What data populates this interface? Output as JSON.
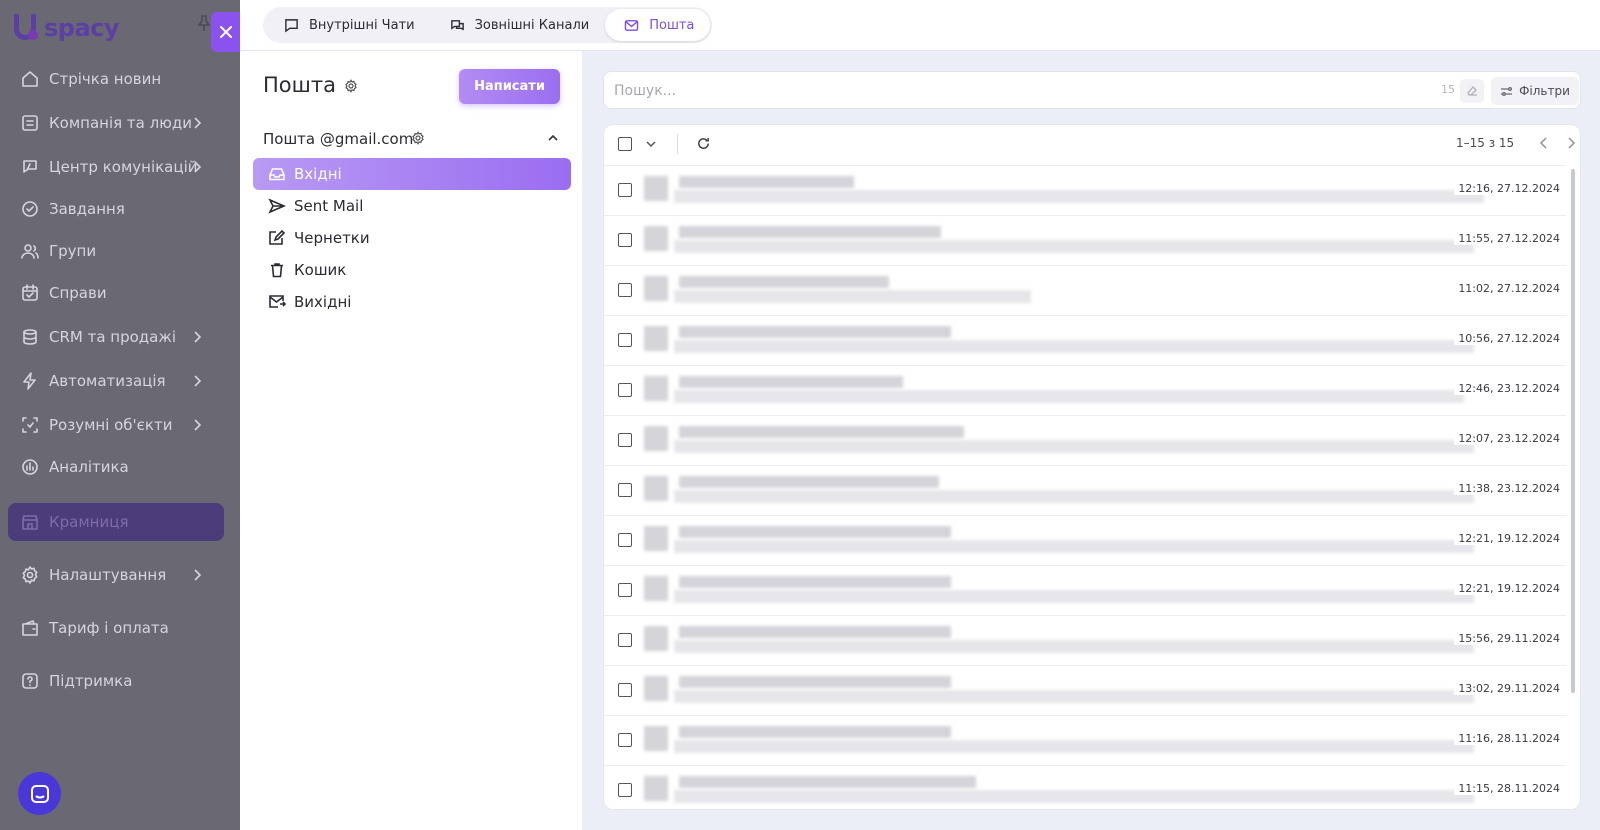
{
  "app": {
    "logo_text": "spacy"
  },
  "sidebar": {
    "items": [
      {
        "label": "Стрічка новин",
        "icon": "home-icon",
        "chevron": false
      },
      {
        "label": "Компанія та люди",
        "icon": "company-icon",
        "chevron": true
      },
      {
        "label": "Центр комунікацій",
        "icon": "communications-icon",
        "chevron": true
      },
      {
        "label": "Завдання",
        "icon": "tasks-icon",
        "chevron": false
      },
      {
        "label": "Групи",
        "icon": "groups-icon",
        "chevron": false
      },
      {
        "label": "Справи",
        "icon": "calendar-icon",
        "chevron": false
      },
      {
        "label": "CRM та продажі",
        "icon": "crm-icon",
        "chevron": true
      },
      {
        "label": "Автоматизація",
        "icon": "lightning-icon",
        "chevron": true
      },
      {
        "label": "Розумні об'єкти",
        "icon": "smart-objects-icon",
        "chevron": true
      },
      {
        "label": "Аналітика",
        "icon": "analytics-icon",
        "chevron": false
      },
      {
        "label": "Крамниця",
        "icon": "store-icon",
        "chevron": false,
        "active": true
      },
      {
        "label": "Налаштування",
        "icon": "gear-icon",
        "chevron": true
      },
      {
        "label": "Тариф і оплата",
        "icon": "wallet-icon",
        "chevron": false
      },
      {
        "label": "Підтримка",
        "icon": "help-icon",
        "chevron": false
      }
    ]
  },
  "tabs": [
    {
      "label": "Внутрішні Чати",
      "icon": "chat-icon",
      "active": false
    },
    {
      "label": "Зовнішні Канали",
      "icon": "channels-icon",
      "active": false
    },
    {
      "label": "Пошта",
      "icon": "mail-icon",
      "active": true
    }
  ],
  "mail": {
    "title": "Пошта",
    "write_button": "Написати",
    "account": "Пошта @gmail.com",
    "folders": [
      {
        "label": "Вхідні",
        "icon": "inbox-icon",
        "active": true
      },
      {
        "label": "Sent Mail",
        "icon": "send-icon",
        "active": false
      },
      {
        "label": "Чернетки",
        "icon": "edit-icon",
        "active": false
      },
      {
        "label": "Кошик",
        "icon": "trash-icon",
        "active": false
      },
      {
        "label": "Вихідні",
        "icon": "outbox-icon",
        "active": false
      }
    ]
  },
  "search": {
    "placeholder": "Пошук...",
    "count": "15",
    "filters_label": "Фільтри"
  },
  "list": {
    "pager": "1–15 з 15",
    "rows": [
      {
        "time": "12:16, 27.12.2024"
      },
      {
        "time": "11:55, 27.12.2024"
      },
      {
        "time": "11:02, 27.12.2024"
      },
      {
        "time": "10:56, 27.12.2024"
      },
      {
        "time": "12:46, 23.12.2024"
      },
      {
        "time": "12:07, 23.12.2024"
      },
      {
        "time": "11:38, 23.12.2024"
      },
      {
        "time": "12:21, 19.12.2024"
      },
      {
        "time": "12:21, 19.12.2024"
      },
      {
        "time": "15:56, 29.11.2024"
      },
      {
        "time": "13:02, 29.11.2024"
      },
      {
        "time": "11:16, 28.11.2024"
      },
      {
        "time": "11:15, 28.11.2024"
      }
    ]
  },
  "colors": {
    "accent": "#8c52f0",
    "sidebar_bg": "#6a6873",
    "chat_bubble": "#4a37d8"
  }
}
